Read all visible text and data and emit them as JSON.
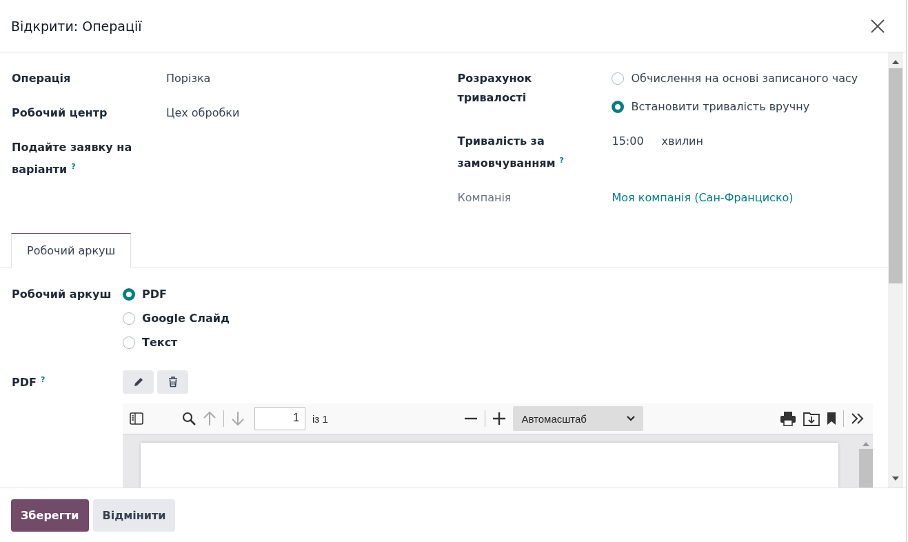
{
  "dialog": {
    "title": "Відкрити: Операції"
  },
  "fields_left": [
    {
      "label": "Операція",
      "value": "Порізка"
    },
    {
      "label": "Робочий центр",
      "value": "Цех обробки"
    },
    {
      "label": "Подайте заявку на варіанти",
      "help": "?"
    }
  ],
  "duration_calc": {
    "label": "Розрахунок тривалості",
    "options": [
      {
        "label": "Обчислення на основі записаного часу",
        "selected": false
      },
      {
        "label": "Встановити тривалість вручну",
        "selected": true
      }
    ]
  },
  "default_duration": {
    "label": "Тривалість за замовчуванням",
    "help": "?",
    "value": "15:00",
    "unit": "хвилин"
  },
  "company": {
    "label": "Компанія",
    "value": "Моя компанія (Сан-Франциско)"
  },
  "tabs": [
    {
      "label": "Робочий аркуш",
      "selected": true
    }
  ],
  "worksheet": {
    "label": "Робочий аркуш",
    "options": [
      {
        "label": "PDF",
        "selected": true
      },
      {
        "label": "Google Слайд",
        "selected": false
      },
      {
        "label": "Текст",
        "selected": false
      }
    ]
  },
  "pdf": {
    "label": "PDF",
    "help": "?",
    "page": "1",
    "page_count": "із 1",
    "zoom": "Автомасштаб"
  },
  "buttons": [
    {
      "label": "Зберегти",
      "kind": "primary"
    },
    {
      "label": "Відмінити",
      "kind": "secondary"
    }
  ]
}
